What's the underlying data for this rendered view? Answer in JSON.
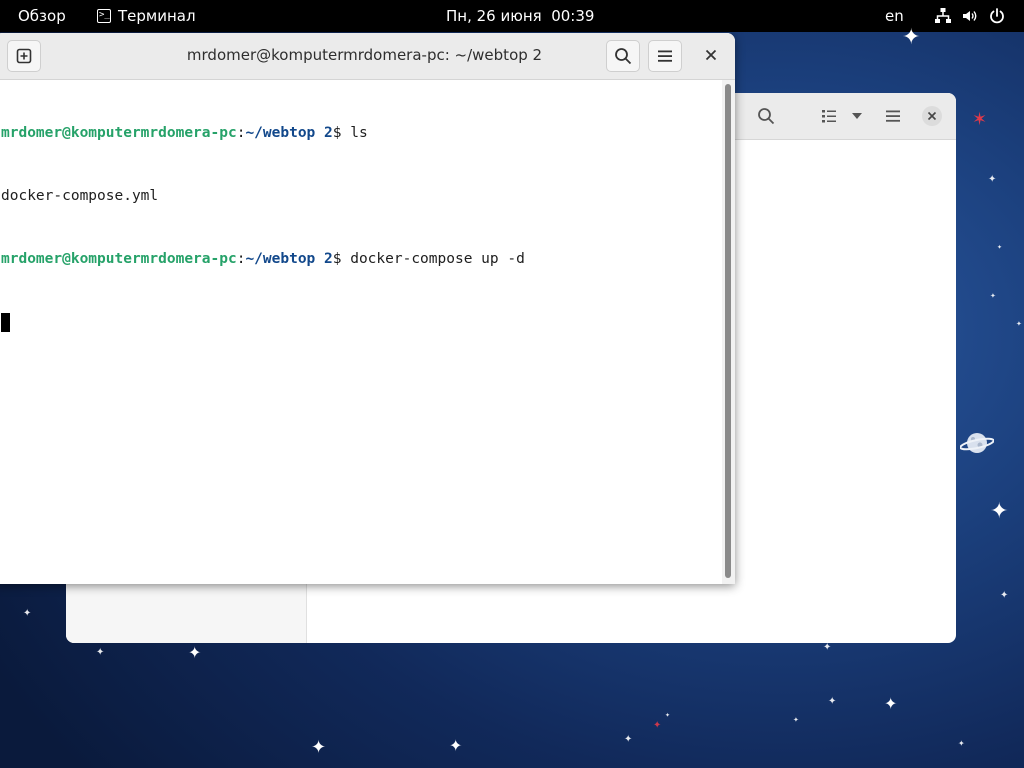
{
  "topbar": {
    "activities": "Обзор",
    "app_menu": "Терминал",
    "clock": "Пн, 26 июня  00:39",
    "language": "en"
  },
  "terminal": {
    "title": "mrdomer@komputermrdomera-pc: ~/webtop 2",
    "lines": [
      {
        "user": "mrdomer@komputermrdomera-pc",
        "sep": ":",
        "path": "~/webtop 2",
        "prompt": "$ ",
        "command": "ls"
      },
      {
        "output": "docker-compose.yml"
      },
      {
        "user": "mrdomer@komputermrdomera-pc",
        "sep": ":",
        "path": "~/webtop 2",
        "prompt": "$ ",
        "command": "docker-compose up -d"
      }
    ]
  },
  "icons": {
    "new_tab": "new-tab-icon",
    "search": "search-icon",
    "menu": "hamburger-menu-icon",
    "close": "close-icon",
    "network": "network-icon",
    "volume": "volume-icon",
    "power": "power-icon",
    "list_view": "list-view-icon",
    "view_dropdown": "chevron-down-icon"
  },
  "colors": {
    "prompt_user": "#26a269",
    "prompt_path": "#12488b",
    "topbar": "#000000",
    "desktop": "#1b3f7c"
  }
}
